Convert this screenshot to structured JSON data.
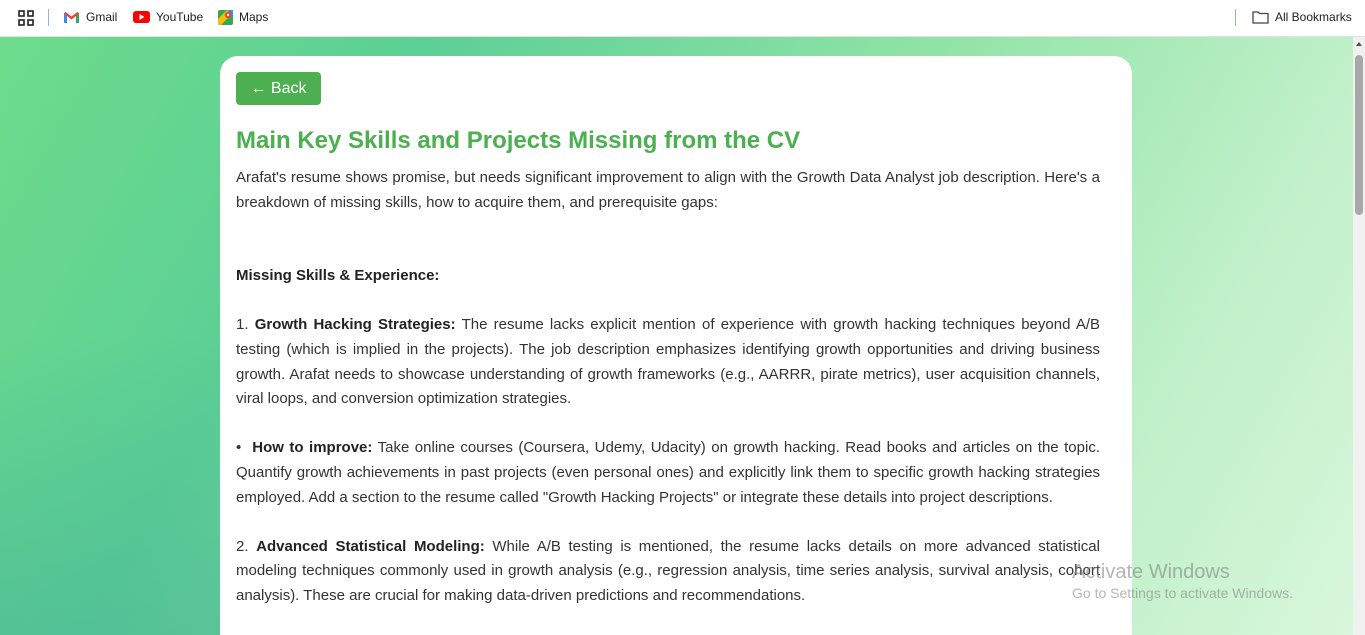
{
  "bookmarks_bar": {
    "items": [
      {
        "label": "Gmail",
        "icon": "gmail-icon"
      },
      {
        "label": "YouTube",
        "icon": "youtube-icon"
      },
      {
        "label": "Maps",
        "icon": "maps-icon"
      }
    ],
    "all_bookmarks_label": "All Bookmarks"
  },
  "card": {
    "back_label": "← Back",
    "title": "Main Key Skills and Projects Missing from the CV",
    "intro": "Arafat's resume shows promise, but needs significant improvement to align with the Growth Data Analyst job description. Here's a breakdown of missing skills, how to acquire them, and prerequisite gaps:",
    "section_heading": "Missing Skills & Experience:",
    "item1": {
      "number": "1.",
      "heading": "Growth Hacking Strategies:",
      "text": "The resume lacks explicit mention of experience with growth hacking techniques beyond A/B testing (which is implied in the projects). The job description emphasizes identifying growth opportunities and driving business growth. Arafat needs to showcase understanding of growth frameworks (e.g., AARRR, pirate metrics), user acquisition channels, viral loops, and conversion optimization strategies."
    },
    "improve1": {
      "bullet": "•",
      "heading": "How to improve:",
      "text": "Take online courses (Coursera, Udemy, Udacity) on growth hacking. Read books and articles on the topic. Quantify growth achievements in past projects (even personal ones) and explicitly link them to specific growth hacking strategies employed. Add a section to the resume called \"Growth Hacking Projects\" or integrate these details into project descriptions."
    },
    "item2": {
      "number": "2.",
      "heading": "Advanced Statistical Modeling:",
      "text": "While A/B testing is mentioned, the resume lacks details on more advanced statistical modeling techniques commonly used in growth analysis (e.g., regression analysis, time series analysis, survival analysis, cohort analysis). These are crucial for making data-driven predictions and recommendations."
    }
  },
  "watermark": {
    "title": "Activate Windows",
    "subtitle": "Go to Settings to activate Windows."
  },
  "colors": {
    "accent": "#4caf50",
    "gmail_red": "#ea4335",
    "youtube_red": "#ff0000"
  }
}
